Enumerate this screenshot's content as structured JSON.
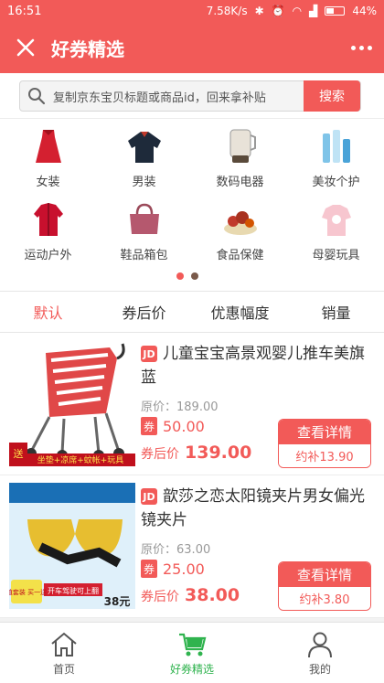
{
  "status_bar": {
    "time": "16:51",
    "network_speed": "7.58K/s",
    "battery": "44%"
  },
  "header": {
    "title": "好券精选",
    "close_icon": "close-icon",
    "more_icon": "more-dots-icon"
  },
  "search": {
    "placeholder": "复制京东宝贝标题或商品id，回来拿补贴",
    "button_label": "搜索"
  },
  "categories": [
    {
      "label": "女装",
      "icon": "dress-icon"
    },
    {
      "label": "男装",
      "icon": "shirt-icon"
    },
    {
      "label": "数码电器",
      "icon": "appliance-icon"
    },
    {
      "label": "美妆个护",
      "icon": "cosmetics-icon"
    },
    {
      "label": "运动户外",
      "icon": "jacket-icon"
    },
    {
      "label": "鞋品箱包",
      "icon": "handbag-icon"
    },
    {
      "label": "食品保健",
      "icon": "food-icon"
    },
    {
      "label": "母婴玩具",
      "icon": "baby-icon"
    }
  ],
  "pager": {
    "active_color": "#f25a58",
    "inactive_color": "#7a5a4a"
  },
  "sort_tabs": [
    {
      "label": "默认",
      "active": true
    },
    {
      "label": "券后价",
      "active": false
    },
    {
      "label": "优惠幅度",
      "active": false
    },
    {
      "label": "销量",
      "active": false
    }
  ],
  "products": [
    {
      "badge": "JD",
      "name": "儿童宝宝高景观婴儿推车美旗蓝",
      "original_label": "原价：",
      "original_price": "189.00",
      "coupon_tag": "券",
      "coupon_amount": "50.00",
      "after_label": "券后价",
      "after_price": "139.00",
      "detail_label": "查看详情",
      "subsidy": "约补13.90",
      "image": {
        "banner_text": "送",
        "promo_text": "坐垫+凉席+蚊帐+玩具"
      }
    },
    {
      "badge": "JD",
      "name": "歆莎之恋太阳镜夹片男女偏光镜夹片",
      "original_label": "原价：",
      "original_price": "63.00",
      "coupon_tag": "券",
      "coupon_amount": "25.00",
      "after_label": "券后价",
      "after_price": "38.00",
      "detail_label": "查看详情",
      "subsidy": "约补3.80",
      "image": {
        "banner_text": "超值套装 买一送二",
        "promo_text": "开车驾驶可上翻",
        "price_tag": "38元"
      }
    }
  ],
  "bottom_nav": [
    {
      "label": "首页",
      "icon": "home-icon",
      "active": false
    },
    {
      "label": "好券精选",
      "icon": "cart-icon",
      "active": true
    },
    {
      "label": "我的",
      "icon": "user-icon",
      "active": false
    }
  ],
  "colors": {
    "brand": "#f25a58",
    "nav_active": "#2fb34e"
  }
}
